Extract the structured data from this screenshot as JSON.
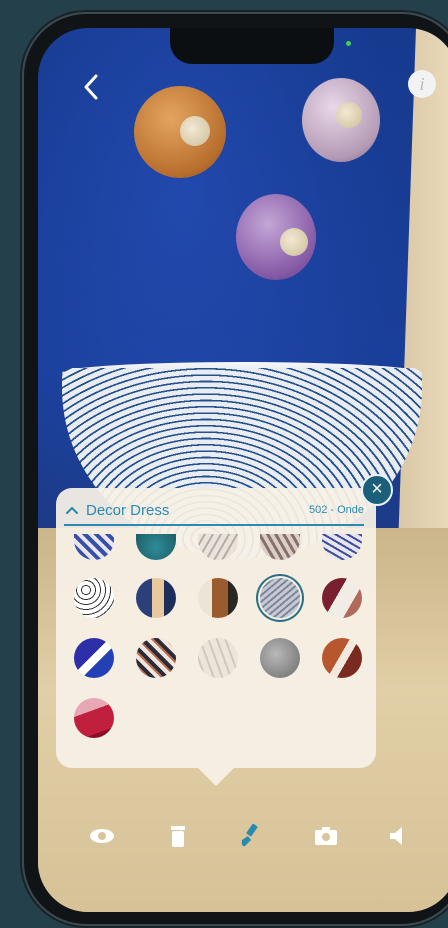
{
  "panel": {
    "title": "Decor Dress",
    "selection_code": "502 - Onde"
  },
  "icons": {
    "back": "chevron-left-icon",
    "info": "info-icon",
    "close": "close-icon",
    "eye": "eye-icon",
    "trash": "trash-icon",
    "brush": "paintbrush-icon",
    "camera": "camera-icon",
    "sound": "speaker-icon"
  },
  "info_symbol": "i",
  "close_symbol": "×",
  "colors": {
    "accent": "#2a8ab0",
    "close_bg": "#1b5f7a",
    "brush_active": "#2a8ab0"
  }
}
